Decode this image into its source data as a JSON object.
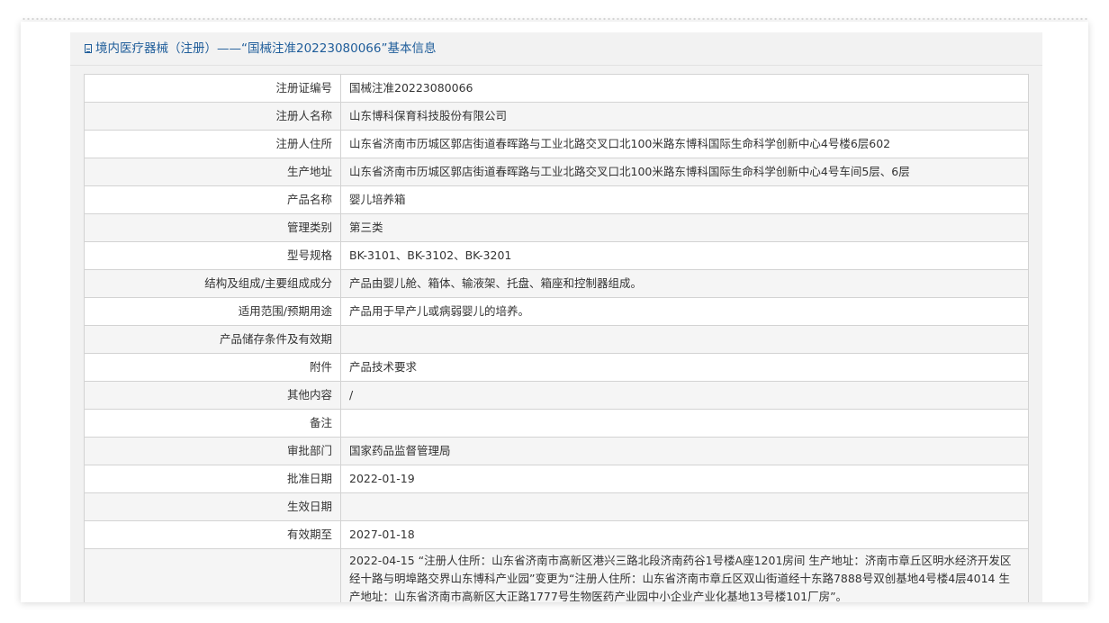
{
  "header": {
    "title": "境内医疗器械（注册）——“国械注准20223080066”基本信息"
  },
  "rows": [
    {
      "label": "注册证编号",
      "value": "国械注准20223080066"
    },
    {
      "label": "注册人名称",
      "value": "山东博科保育科技股份有限公司"
    },
    {
      "label": "注册人住所",
      "value": "山东省济南市历城区郭店街道春晖路与工业北路交叉口北100米路东博科国际生命科学创新中心4号楼6层602"
    },
    {
      "label": "生产地址",
      "value": "山东省济南市历城区郭店街道春晖路与工业北路交叉口北100米路东博科国际生命科学创新中心4号车间5层、6层"
    },
    {
      "label": "产品名称",
      "value": "婴儿培养箱"
    },
    {
      "label": "管理类别",
      "value": "第三类"
    },
    {
      "label": "型号规格",
      "value": "BK-3101、BK-3102、BK-3201"
    },
    {
      "label": "结构及组成/主要组成成分",
      "value": "产品由婴儿舱、箱体、输液架、托盘、箱座和控制器组成。"
    },
    {
      "label": "适用范围/预期用途",
      "value": "产品用于早产儿或病弱婴儿的培养。"
    },
    {
      "label": "产品储存条件及有效期",
      "value": ""
    },
    {
      "label": "附件",
      "value": "产品技术要求"
    },
    {
      "label": "其他内容",
      "value": "/"
    },
    {
      "label": "备注",
      "value": ""
    },
    {
      "label": "审批部门",
      "value": "国家药品监督管理局"
    },
    {
      "label": "批准日期",
      "value": "2022-01-19"
    },
    {
      "label": "生效日期",
      "value": ""
    },
    {
      "label": "有效期至",
      "value": "2027-01-18"
    },
    {
      "label": "",
      "value": "2022-04-15 “注册人住所：山东省济南市高新区港兴三路北段济南药谷1号楼A座1201房间 生产地址：济南市章丘区明水经济开发区经十路与明埠路交界山东博科产业园”变更为“注册人住所：山东省济南市章丘区双山街道经十东路7888号双创基地4号楼4层4014 生产地址：山东省济南市高新区大正路1777号生物医药产业园中小企业产业化基地13号楼101厂房”。"
    }
  ]
}
